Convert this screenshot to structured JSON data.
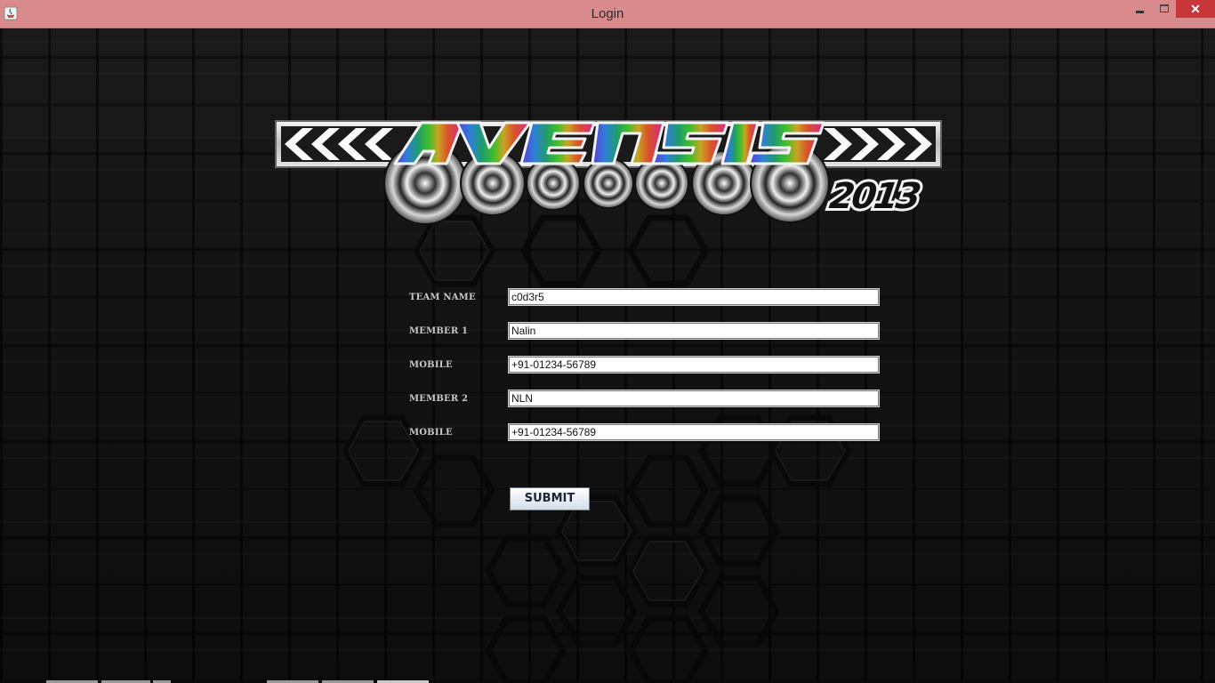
{
  "window": {
    "title": "Login",
    "close_glyph": "✕",
    "titlebar_color": "#d88a8d",
    "close_color": "#c7373a"
  },
  "logo": {
    "icon": "avensis-2013-logo"
  },
  "form": {
    "fields": [
      {
        "label": "TEAM NAME",
        "value": "c0d3r5"
      },
      {
        "label": "MEMBER 1",
        "value": "Nalin"
      },
      {
        "label": "MOBILE",
        "value": "+91-01234-56789"
      },
      {
        "label": "MEMBER 2",
        "value": "NLN"
      },
      {
        "label": "MOBILE",
        "value": "+91-01234-56789"
      }
    ],
    "submit_label": "SUBMIT"
  }
}
